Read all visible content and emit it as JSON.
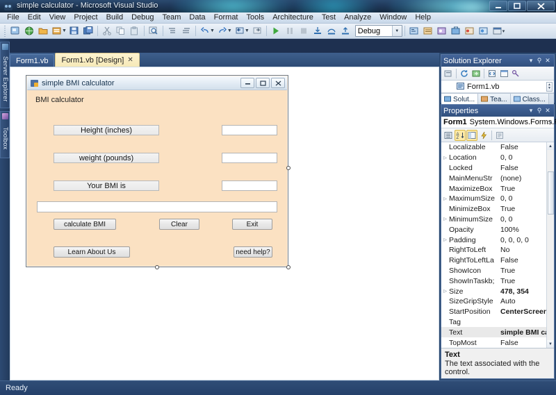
{
  "window": {
    "title": "simple calculator - Microsoft Visual Studio",
    "app_icon": "visual-studio-icon",
    "minimize": "—",
    "maximize": "❐",
    "close": "✕"
  },
  "menubar": {
    "items": [
      {
        "label": "File"
      },
      {
        "label": "Edit"
      },
      {
        "label": "View"
      },
      {
        "label": "Project"
      },
      {
        "label": "Build"
      },
      {
        "label": "Debug"
      },
      {
        "label": "Team"
      },
      {
        "label": "Data"
      },
      {
        "label": "Format"
      },
      {
        "label": "Tools"
      },
      {
        "label": "Architecture"
      },
      {
        "label": "Test"
      },
      {
        "label": "Analyze"
      },
      {
        "label": "Window"
      },
      {
        "label": "Help"
      }
    ]
  },
  "toolbar": {
    "config_value": "Debug",
    "icons": [
      "new-project-icon",
      "add-web-site-icon",
      "open-file-icon",
      "add-new-item-icon",
      "save-icon",
      "save-all-icon",
      "cut-icon",
      "copy-icon",
      "paste-icon",
      "find-icon",
      "comment-icon",
      "uncomment-icon",
      "undo-icon",
      "redo-icon",
      "navigate-backward-icon",
      "navigate-forward-icon",
      "start-debugging-icon",
      "pause-icon",
      "stop-icon",
      "step-into-icon",
      "step-over-icon",
      "step-out-icon",
      "solution-explorer-icon",
      "properties-window-icon",
      "object-browser-icon",
      "toolbox-icon",
      "error-list-icon",
      "class-view-icon",
      "team-explorer-icon",
      "output-icon"
    ]
  },
  "left_dock": {
    "tabs": [
      {
        "label": "Server Explorer",
        "icon": "server-explorer-icon"
      },
      {
        "label": "Toolbox",
        "icon": "toolbox-icon"
      }
    ]
  },
  "editor_tabs": [
    {
      "label": "Form1.vb",
      "active": false,
      "closable": false
    },
    {
      "label": "Form1.vb [Design]",
      "active": true,
      "closable": true,
      "close_glyph": "✕"
    }
  ],
  "designer": {
    "form": {
      "title": "simple BMI calculator",
      "icon": "vb-form-icon",
      "caption_buttons": [
        {
          "name": "minimize",
          "glyph": "▬"
        },
        {
          "name": "maximize",
          "glyph": "❐"
        },
        {
          "name": "close",
          "glyph": "✕"
        }
      ],
      "heading_label": "BMI calculator",
      "labels": [
        {
          "text": "Height (inches)"
        },
        {
          "text": "weight (pounds)"
        },
        {
          "text": "Your BMI is"
        }
      ],
      "textboxes": [
        {
          "name": "height-textbox",
          "value": ""
        },
        {
          "name": "weight-textbox",
          "value": ""
        },
        {
          "name": "bmi-result-textbox",
          "value": ""
        },
        {
          "name": "message-textbox",
          "value": ""
        }
      ],
      "buttons": [
        {
          "text": "calculate BMI"
        },
        {
          "text": "Clear"
        },
        {
          "text": "Exit"
        },
        {
          "text": "Learn About Us"
        },
        {
          "text": "need help?"
        }
      ]
    }
  },
  "solution_explorer": {
    "title": "Solution Explorer",
    "header_icons": [
      {
        "name": "dropdown-icon",
        "glyph": "▾"
      },
      {
        "name": "auto-hide-pin-icon",
        "glyph": "⚲"
      },
      {
        "name": "close-icon",
        "glyph": "✕"
      }
    ],
    "toolbar_icons": [
      "properties-icon",
      "refresh-icon",
      "show-all-files-icon",
      "view-code-icon",
      "view-designer-icon",
      "view-class-diagram-icon"
    ],
    "tree": [
      {
        "label": "Form1.vb",
        "icon": "vb-file-icon"
      }
    ],
    "bottom_tabs": [
      {
        "label": "Solut...",
        "icon": "solution-explorer-icon",
        "active": true
      },
      {
        "label": "Tea...",
        "icon": "team-explorer-icon",
        "active": false
      },
      {
        "label": "Class...",
        "icon": "class-view-icon",
        "active": false
      }
    ]
  },
  "properties": {
    "title": "Properties",
    "header_icons": [
      {
        "name": "dropdown-icon",
        "glyph": "▾"
      },
      {
        "name": "auto-hide-pin-icon",
        "glyph": "⚲"
      },
      {
        "name": "close-icon",
        "glyph": "✕"
      }
    ],
    "object_name": "Form1",
    "object_type": "System.Windows.Forms.Fo",
    "object_caret": "▾",
    "toolbar_icons": [
      {
        "name": "categorized-icon",
        "selected": false
      },
      {
        "name": "alphabetical-icon",
        "selected": true
      },
      {
        "name": "properties-icon",
        "selected": true
      },
      {
        "name": "events-icon",
        "selected": false
      },
      {
        "name": "property-pages-icon",
        "selected": false
      }
    ],
    "rows": [
      {
        "name": "Localizable",
        "value": "False",
        "expandable": false,
        "bold": false
      },
      {
        "name": "Location",
        "value": "0, 0",
        "expandable": true,
        "bold": false
      },
      {
        "name": "Locked",
        "value": "False",
        "expandable": false,
        "bold": false
      },
      {
        "name": "MainMenuStr",
        "value": "(none)",
        "expandable": false,
        "bold": false
      },
      {
        "name": "MaximizeBox",
        "value": "True",
        "expandable": false,
        "bold": false
      },
      {
        "name": "MaximumSize",
        "value": "0, 0",
        "expandable": true,
        "bold": false
      },
      {
        "name": "MinimizeBox",
        "value": "True",
        "expandable": false,
        "bold": false
      },
      {
        "name": "MinimumSize",
        "value": "0, 0",
        "expandable": true,
        "bold": false
      },
      {
        "name": "Opacity",
        "value": "100%",
        "expandable": false,
        "bold": false
      },
      {
        "name": "Padding",
        "value": "0, 0, 0, 0",
        "expandable": true,
        "bold": false
      },
      {
        "name": "RightToLeft",
        "value": "No",
        "expandable": false,
        "bold": false
      },
      {
        "name": "RightToLeftLa",
        "value": "False",
        "expandable": false,
        "bold": false
      },
      {
        "name": "ShowIcon",
        "value": "True",
        "expandable": false,
        "bold": false
      },
      {
        "name": "ShowInTaskb;",
        "value": "True",
        "expandable": false,
        "bold": false
      },
      {
        "name": "Size",
        "value": "478, 354",
        "expandable": true,
        "bold": true
      },
      {
        "name": "SizeGripStyle",
        "value": "Auto",
        "expandable": false,
        "bold": false
      },
      {
        "name": "StartPosition",
        "value": "CenterScreen",
        "expandable": false,
        "bold": true
      },
      {
        "name": "Tag",
        "value": "",
        "expandable": false,
        "bold": false
      },
      {
        "name": "Text",
        "value": "simple BMI calc",
        "expandable": false,
        "bold": true,
        "selected": true
      },
      {
        "name": "TopMost",
        "value": "False",
        "expandable": false,
        "bold": false
      }
    ],
    "scroll_up": "▲",
    "scroll_down": "▼",
    "description": {
      "term": "Text",
      "detail": "The text associated with the control."
    }
  },
  "statusbar": {
    "message": "Ready"
  }
}
